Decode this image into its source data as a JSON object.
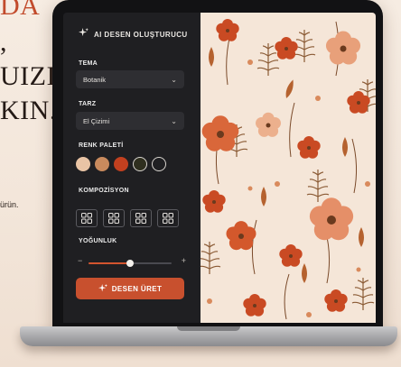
{
  "background_text": {
    "lines": [
      "DA",
      ",",
      "UIZI",
      "KIN."
    ],
    "caption": "ürün."
  },
  "panel": {
    "title": "AI DESEN OLUŞTURUCU",
    "title_icon": "sparkles-icon",
    "theme": {
      "label": "TEMA",
      "value": "Botanik"
    },
    "style": {
      "label": "TARZ",
      "value": "El Çizimi"
    },
    "palette": {
      "label": "RENK PALETİ",
      "colors": [
        "#e9c4a5",
        "#c98a5d",
        "#c2401f",
        "#2f2f1f",
        ""
      ]
    },
    "composition": {
      "label": "KOMPOZİSYON",
      "options": 4
    },
    "density": {
      "label": "YOĞUNLUK",
      "minus": "−",
      "plus": "+",
      "value": 0.5
    },
    "generate_button": "DESEN ÜRET"
  },
  "colors": {
    "accent": "#c8502e",
    "panel_bg": "#1f1f22",
    "pattern_bg": "#f5e6d8"
  }
}
